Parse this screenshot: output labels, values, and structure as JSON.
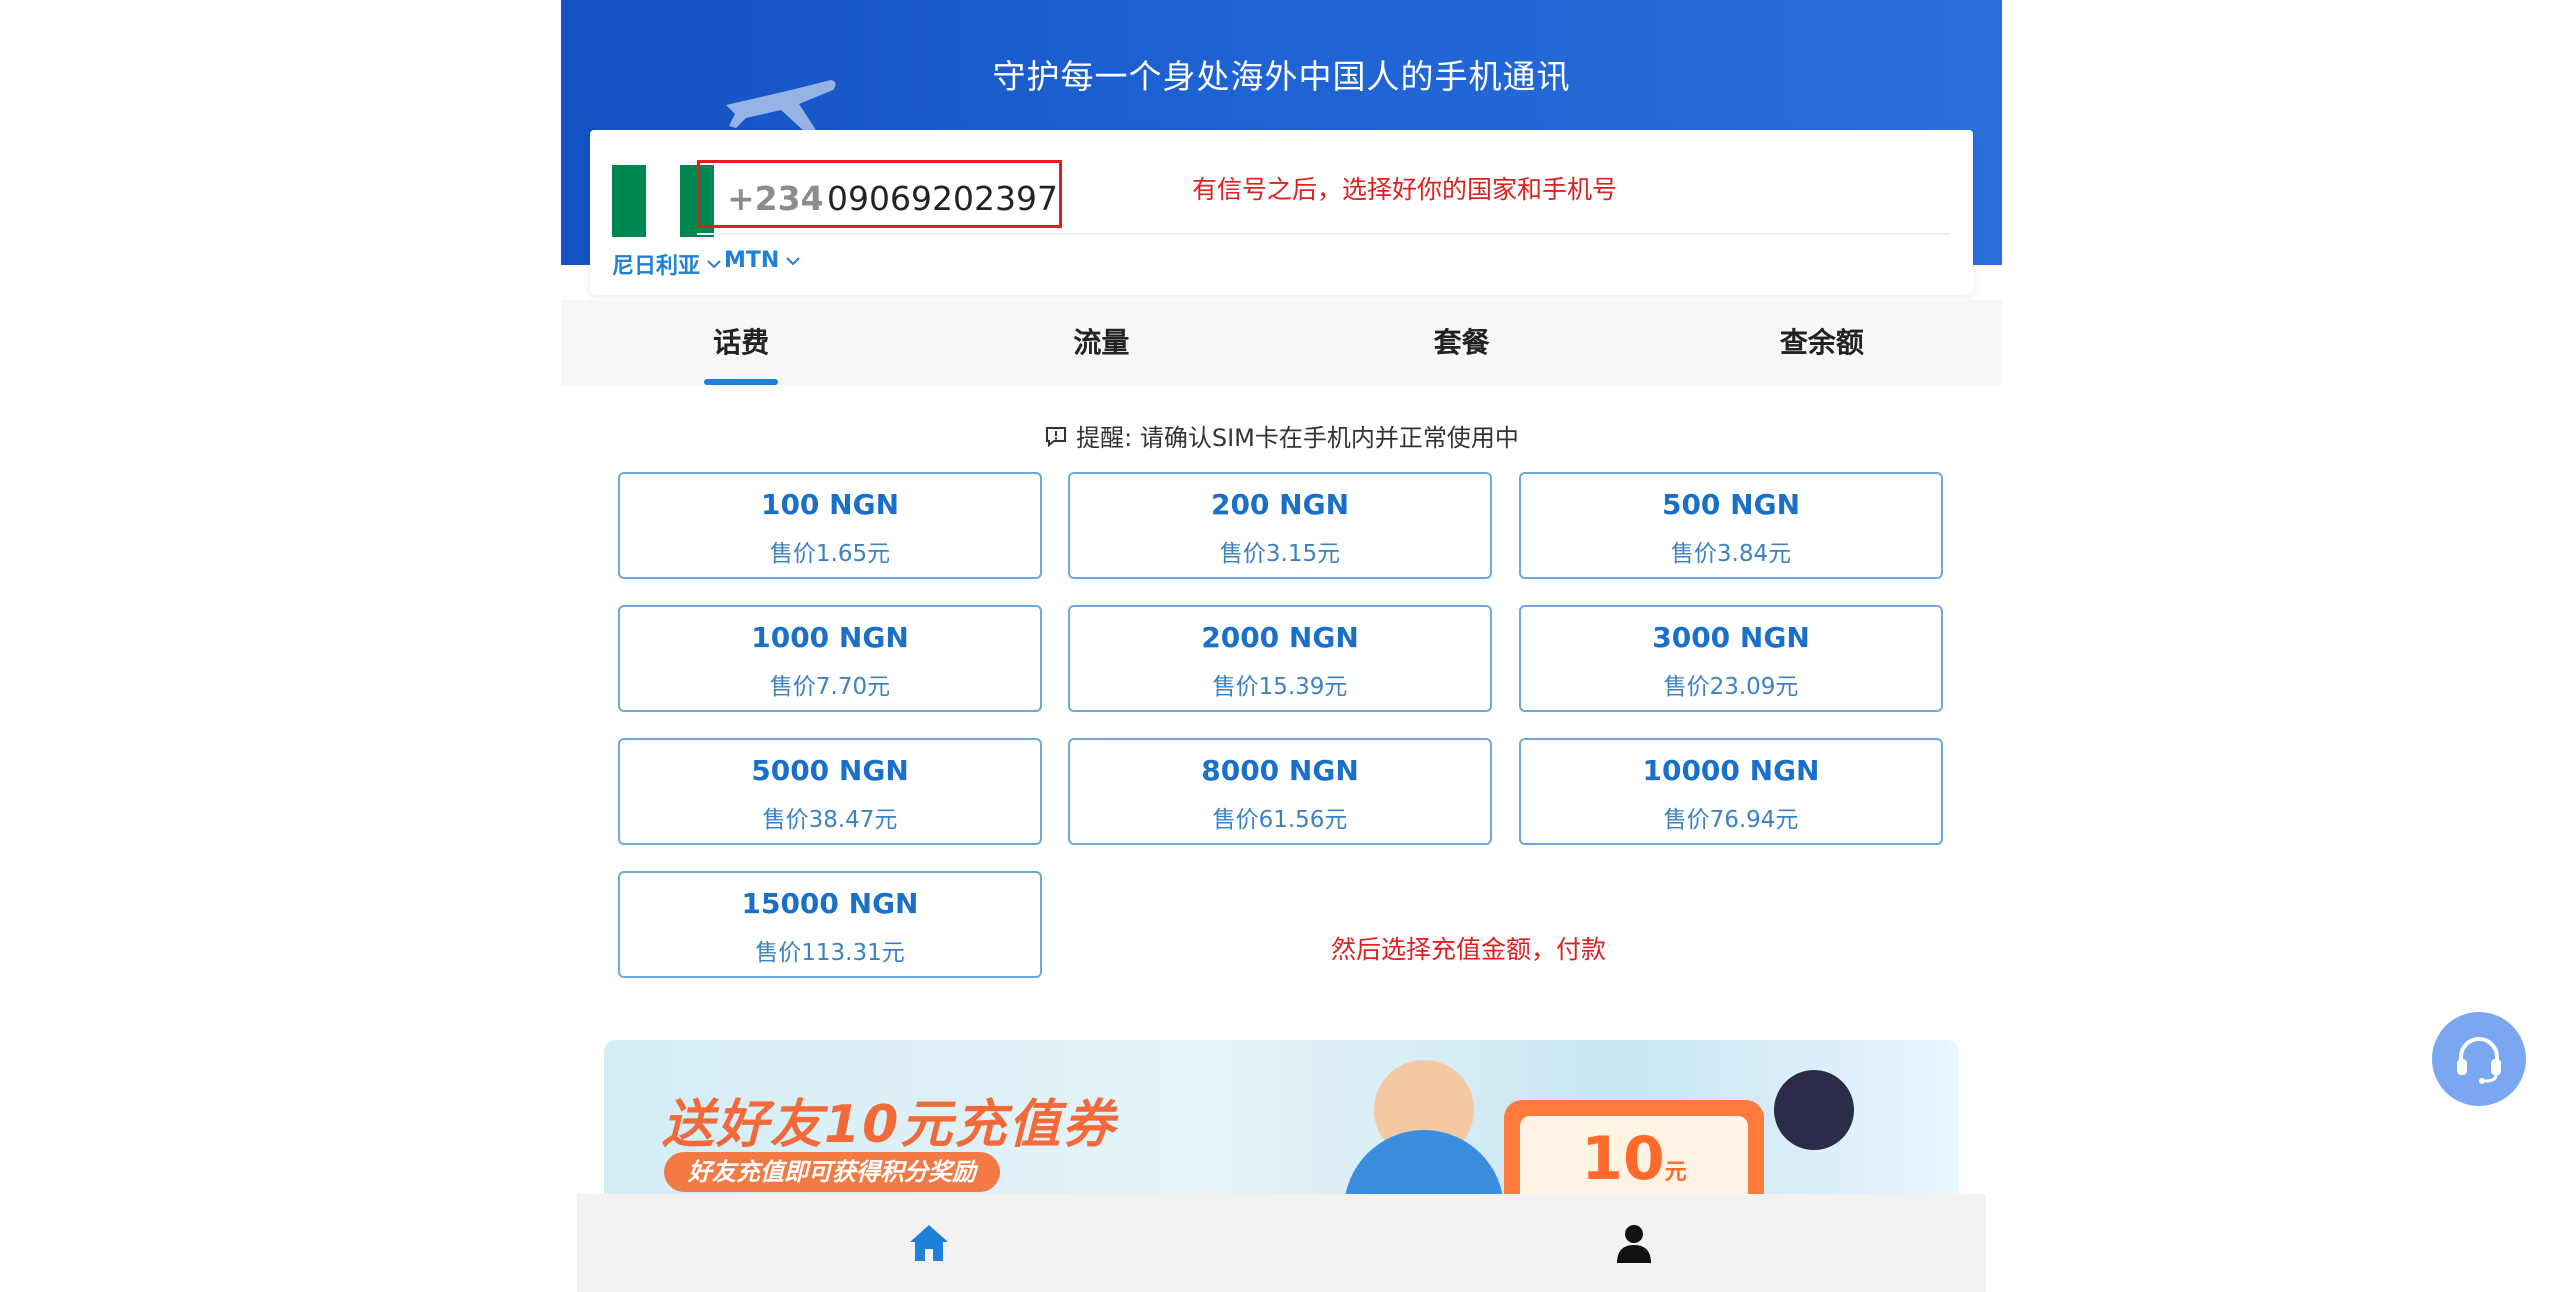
{
  "header": {
    "title": "守护每一个身处海外中国人的手机通讯"
  },
  "phone": {
    "dial_code": "+234",
    "number": "09069202397",
    "country": "尼日利亚",
    "operator": "MTN",
    "flag_colors": [
      "#008751",
      "#ffffff",
      "#008751"
    ]
  },
  "annotations": {
    "hint_top": "有信号之后，选择好你的国家和手机号",
    "hint_bottom": "然后选择充值金额，付款"
  },
  "tabs": [
    {
      "label": "话费",
      "active": true
    },
    {
      "label": "流量",
      "active": false
    },
    {
      "label": "套餐",
      "active": false
    },
    {
      "label": "查余额",
      "active": false
    }
  ],
  "notice": {
    "text": "提醒: 请确认SIM卡在手机内并正常使用中",
    "icon": "alert-message-icon"
  },
  "products": [
    {
      "amount": "100 NGN",
      "price": "售价1.65元"
    },
    {
      "amount": "200 NGN",
      "price": "售价3.15元"
    },
    {
      "amount": "500 NGN",
      "price": "售价3.84元"
    },
    {
      "amount": "1000 NGN",
      "price": "售价7.70元"
    },
    {
      "amount": "2000 NGN",
      "price": "售价15.39元"
    },
    {
      "amount": "3000 NGN",
      "price": "售价23.09元"
    },
    {
      "amount": "5000 NGN",
      "price": "售价38.47元"
    },
    {
      "amount": "8000 NGN",
      "price": "售价61.56元"
    },
    {
      "amount": "10000 NGN",
      "price": "售价76.94元"
    },
    {
      "amount": "15000 NGN",
      "price": "售价113.31元"
    }
  ],
  "banner": {
    "title": "送好友10元充值券",
    "subtitle": "好友充值即可获得积分奖励",
    "coupon_value": "10",
    "coupon_unit": "元"
  },
  "bottom_nav": [
    {
      "icon": "home-icon",
      "active": true
    },
    {
      "icon": "user-icon",
      "active": false
    }
  ],
  "colors": {
    "primary": "#1e80d8",
    "hero": "#1f63d4",
    "annotation": "#e02020",
    "card_border": "#6fa8dc"
  }
}
